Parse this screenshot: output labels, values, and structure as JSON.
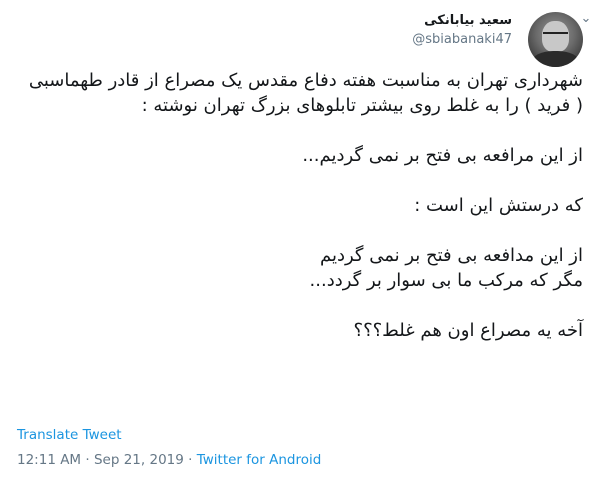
{
  "header": {
    "display_name": "سعید بیابانکی",
    "handle": "@sbiabanaki47",
    "caret_icon": "chevron-down-icon"
  },
  "tweet": {
    "lines": [
      "شهرداری تهران به مناسبت هفته دفاع مقدس یک مصراع از قادر طهماسبی",
      "( فرید ) را به غلط روی بیشتر تابلوهای بزرگ تهران نوشته :",
      "",
      "از این مرافعه بی فتح بر نمی گردیم...",
      "",
      "که درستش این است :",
      "",
      "از این مدافعه بی فتح بر نمی گردیم",
      "مگر که مرکب ما بی سوار بر گردد...",
      "",
      "آخه یه مصراع اون هم غلط؟؟؟"
    ]
  },
  "footer": {
    "translate_label": "Translate Tweet",
    "time": "12:11 AM",
    "separator": "·",
    "date": "Sep 21, 2019",
    "source": "Twitter for Android"
  },
  "colors": {
    "link": "#1b95e0",
    "muted": "#657786",
    "text": "#14171a"
  }
}
